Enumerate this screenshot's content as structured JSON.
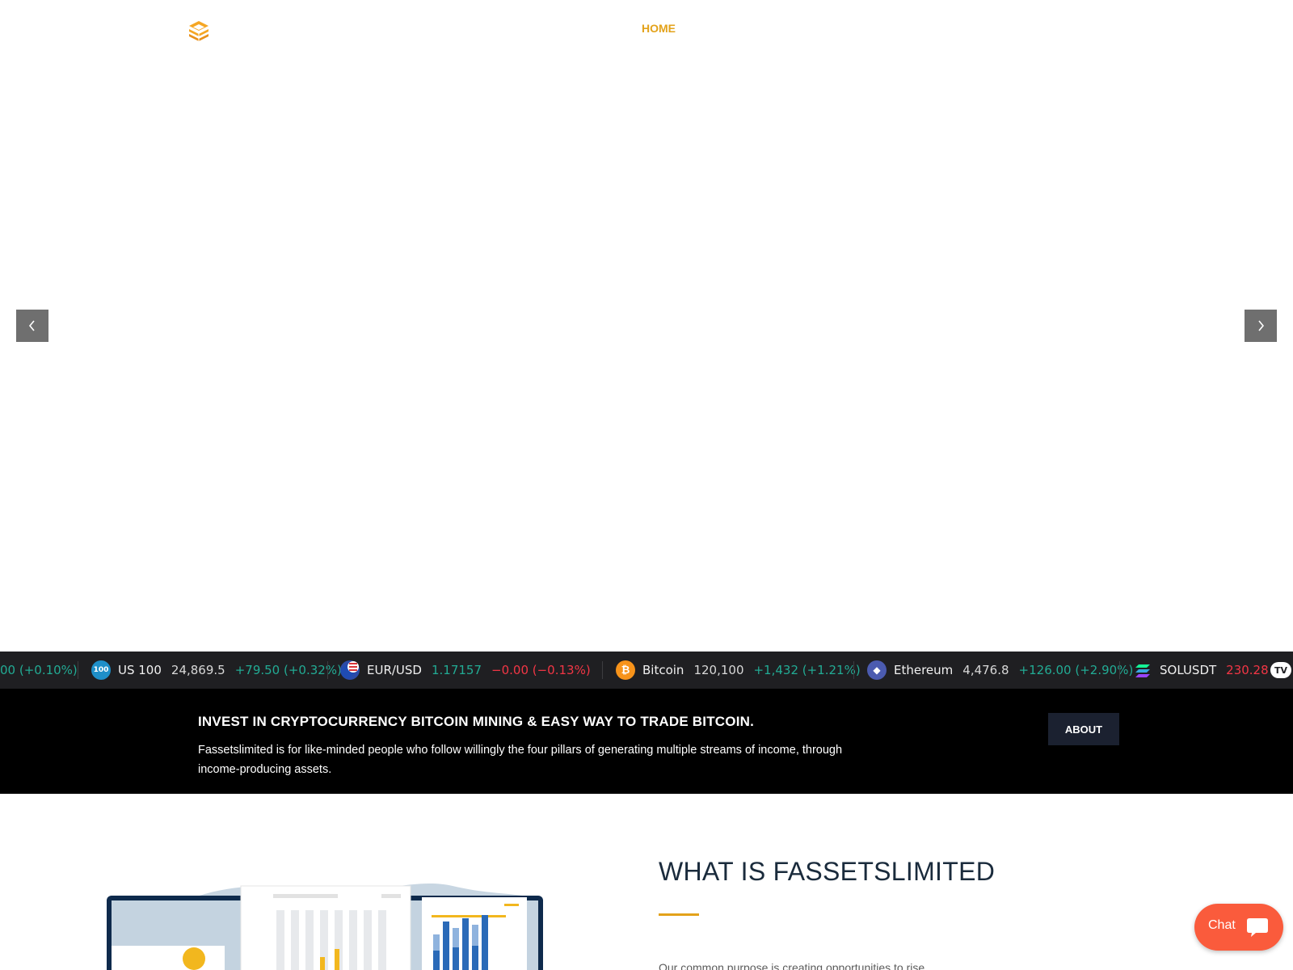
{
  "header": {
    "logo_icon": "stacked-cubes-logo",
    "nav": [
      {
        "label": "HOME",
        "active": true
      }
    ]
  },
  "slider": {
    "prev_icon": "chevron-left-icon",
    "next_icon": "chevron-right-icon"
  },
  "ticker": {
    "items": [
      {
        "name": "",
        "price": "",
        "change": "00 (+0.10%)",
        "dir": "up",
        "icon": ""
      },
      {
        "name": "US 100",
        "price": "24,869.5",
        "change": "+79.50 (+0.32%)",
        "dir": "up",
        "icon": "us100-icon",
        "icon_text": "100"
      },
      {
        "name": "EUR/USD",
        "price": "1.17157",
        "change": "−0.00 (−0.13%)",
        "dir": "down",
        "icon": "eur-usd-flag-icon"
      },
      {
        "name": "Bitcoin",
        "price": "120,100",
        "change": "+1,432 (+1.21%)",
        "dir": "up",
        "icon": "bitcoin-icon",
        "icon_text": "₿"
      },
      {
        "name": "Ethereum",
        "price": "4,476.8",
        "change": "+126.00 (+2.90%)",
        "dir": "up",
        "icon": "ethereum-icon",
        "icon_text": "◆"
      },
      {
        "name": "SOLUSDT",
        "price": "230.28",
        "change": "",
        "dir": "down",
        "icon": "solana-icon"
      }
    ],
    "brand": "TV"
  },
  "banner": {
    "title": "INVEST IN CRYPTOCURRENCY BITCOIN MINING & EASY WAY TO TRADE BITCOIN.",
    "text": "Fassetslimited is for like-minded people who follow willingly the four pillars of generating multiple streams of income, through income-producing assets.",
    "button": "ABOUT"
  },
  "about": {
    "heading": "WHAT IS FASSETSLIMITED",
    "paragraph": "Our common purpose is creating opportunities to rise"
  },
  "chat": {
    "label": "Chat",
    "icon": "chat-bubble-icon"
  },
  "colors": {
    "accent": "#e3a21a",
    "ticker_bg": "#1f1f22",
    "up": "#22ab94",
    "down": "#f23645",
    "chat": "#fa5b3c"
  }
}
